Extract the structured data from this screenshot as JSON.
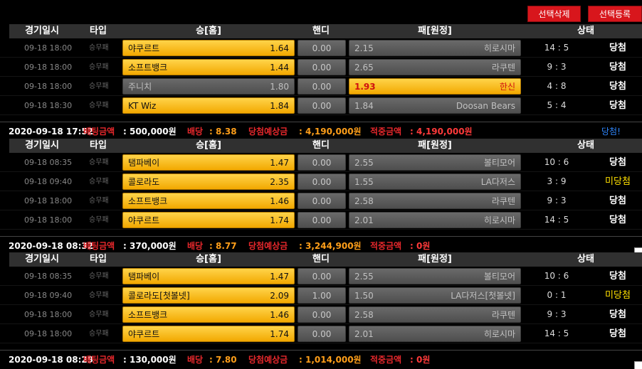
{
  "toolbar": {
    "delete_label": "선택삭제",
    "register_label": "선택등록"
  },
  "headers": {
    "datetime": "경기일시",
    "type": "타입",
    "home": "승[홈]",
    "handicap": "핸디",
    "away": "패[원정]",
    "status": "상태"
  },
  "slips": [
    {
      "rows": [
        {
          "dt": "09-18 18:00",
          "type": "승무패",
          "home": "야쿠르트",
          "home_odds": "1.64",
          "hc": "0.00",
          "away": "히로시마",
          "away_odds": "2.15",
          "pick": "home",
          "score": "14 : 5",
          "result": "당첨"
        },
        {
          "dt": "09-18 18:00",
          "type": "승무패",
          "home": "소프트뱅크",
          "home_odds": "1.44",
          "hc": "0.00",
          "away": "라쿠텐",
          "away_odds": "2.65",
          "pick": "home",
          "score": "9 : 3",
          "result": "당첨"
        },
        {
          "dt": "09-18 18:00",
          "type": "승무패",
          "home": "주니치",
          "home_odds": "1.80",
          "hc": "0.00",
          "away": "한신",
          "away_odds": "1.93",
          "pick": "away",
          "score": "4 : 8",
          "result": "당첨"
        },
        {
          "dt": "09-18 18:30",
          "type": "승무패",
          "home": "KT Wiz",
          "home_odds": "1.84",
          "hc": "0.00",
          "away": "Doosan Bears",
          "away_odds": "1.84",
          "pick": "home",
          "score": "5 : 4",
          "result": "당첨"
        }
      ],
      "summary": {
        "time": "2020-09-18 17:52",
        "bet_label": "배팅금액",
        "bet": ": 500,000원",
        "odds_label": "배당",
        "odds": ": 8.38",
        "expected_label": "당첨예상금",
        "expected": ": 4,190,000원",
        "hit_label": "적중금액",
        "hit": ": 4,190,000원",
        "status": "당첨!"
      }
    },
    {
      "rows": [
        {
          "dt": "09-18 08:35",
          "type": "승무패",
          "home": "탬파베이",
          "home_odds": "1.47",
          "hc": "0.00",
          "away": "볼티모어",
          "away_odds": "2.55",
          "pick": "home",
          "score": "10 : 6",
          "result": "당첨"
        },
        {
          "dt": "09-18 09:40",
          "type": "승무패",
          "home": "콜로라도",
          "home_odds": "2.35",
          "hc": "0.00",
          "away": "LA다저스",
          "away_odds": "1.55",
          "pick": "home",
          "score": "3 : 9",
          "result": "미당첨"
        },
        {
          "dt": "09-18 18:00",
          "type": "승무패",
          "home": "소프트뱅크",
          "home_odds": "1.46",
          "hc": "0.00",
          "away": "라쿠텐",
          "away_odds": "2.58",
          "pick": "home",
          "score": "9 : 3",
          "result": "당첨"
        },
        {
          "dt": "09-18 18:00",
          "type": "승무패",
          "home": "야쿠르트",
          "home_odds": "1.74",
          "hc": "0.00",
          "away": "히로시마",
          "away_odds": "2.01",
          "pick": "home",
          "score": "14 : 5",
          "result": "당첨"
        }
      ],
      "summary": {
        "time": "2020-09-18 08:32",
        "bet_label": "배팅금액",
        "bet": ": 370,000원",
        "odds_label": "배당",
        "odds": ": 8.77",
        "expected_label": "당첨예상금",
        "expected": ": 3,244,900원",
        "hit_label": "적중금액",
        "hit": ": 0원",
        "status": ""
      }
    },
    {
      "rows": [
        {
          "dt": "09-18 08:35",
          "type": "승무패",
          "home": "탬파베이",
          "home_odds": "1.47",
          "hc": "0.00",
          "away": "볼티모어",
          "away_odds": "2.55",
          "pick": "home",
          "score": "10 : 6",
          "result": "당첨"
        },
        {
          "dt": "09-18 09:40",
          "type": "승무패",
          "home": "콜로라도[첫볼넷]",
          "home_odds": "2.09",
          "hc": "1.00",
          "away": "LA다저스[첫볼넷]",
          "away_odds": "1.50",
          "pick": "home",
          "score": "0 : 1",
          "result": "미당첨"
        },
        {
          "dt": "09-18 18:00",
          "type": "승무패",
          "home": "소프트뱅크",
          "home_odds": "1.46",
          "hc": "0.00",
          "away": "라쿠텐",
          "away_odds": "2.58",
          "pick": "home",
          "score": "9 : 3",
          "result": "당첨"
        },
        {
          "dt": "09-18 18:00",
          "type": "승무패",
          "home": "야쿠르트",
          "home_odds": "1.74",
          "hc": "0.00",
          "away": "히로시마",
          "away_odds": "2.01",
          "pick": "home",
          "score": "14 : 5",
          "result": "당첨"
        }
      ],
      "summary": {
        "time": "2020-09-18 08:29",
        "bet_label": "배팅금액",
        "bet": ": 130,000원",
        "odds_label": "배당",
        "odds": ": 7.80",
        "expected_label": "당첨예상금",
        "expected": ": 1,014,000원",
        "hit_label": "적중금액",
        "hit": ": 0원",
        "status": ""
      }
    }
  ]
}
